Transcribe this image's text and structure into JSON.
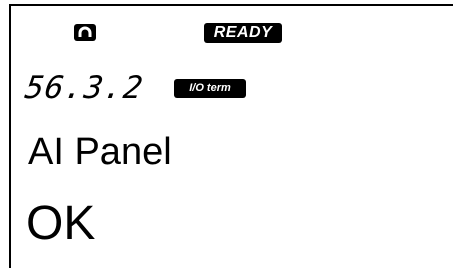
{
  "status": {
    "icon": "keypad-control-icon",
    "state_label": "READY"
  },
  "menu": {
    "code": "56.3.2",
    "control_place": "I/O term"
  },
  "parameter": {
    "name": "AI Panel",
    "value": "OK"
  },
  "colors": {
    "foreground": "#000000",
    "background": "#ffffff"
  }
}
